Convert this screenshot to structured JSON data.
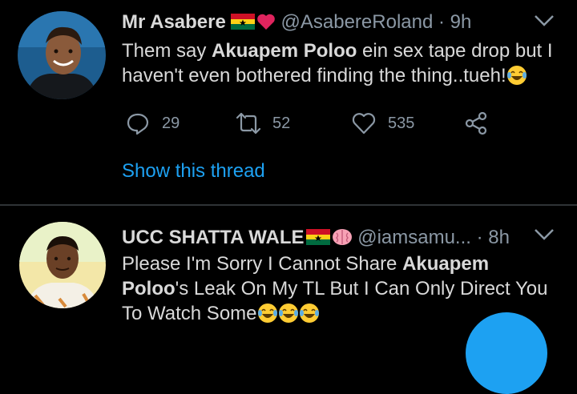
{
  "tweets": [
    {
      "name": "Mr Asabere",
      "handle": "@AsabereRoland",
      "time": "· 9h",
      "text": {
        "pre": "Them say ",
        "bold": "Akuapem Poloo",
        "post": " ein sex tape drop but I haven't even bothered finding the thing..tueh!"
      },
      "actions": {
        "replies": "29",
        "retweets": "52",
        "likes": "535"
      },
      "show_thread": "Show this thread"
    },
    {
      "name": "UCC SHATTA WALE",
      "handle": "@iamsamu...",
      "time": "· 8h",
      "text": {
        "pre": "Please I'm Sorry I Cannot Share ",
        "bold": "Akuapem Poloo",
        "post": "'s Leak On My TL But I Can Only Direct You To Watch Some"
      }
    }
  ],
  "colors": {
    "background": "#000000",
    "text": "#d9d9d9",
    "muted": "#8b98a5",
    "accent": "#1da1f2",
    "divider": "#2f3336"
  },
  "icons": [
    "ghana-flag-icon",
    "red-heart-icon",
    "brain-icon",
    "chevron-down-icon",
    "reply-icon",
    "retweet-icon",
    "like-icon",
    "share-icon",
    "laughing-emoji-icon",
    "compose-button"
  ]
}
